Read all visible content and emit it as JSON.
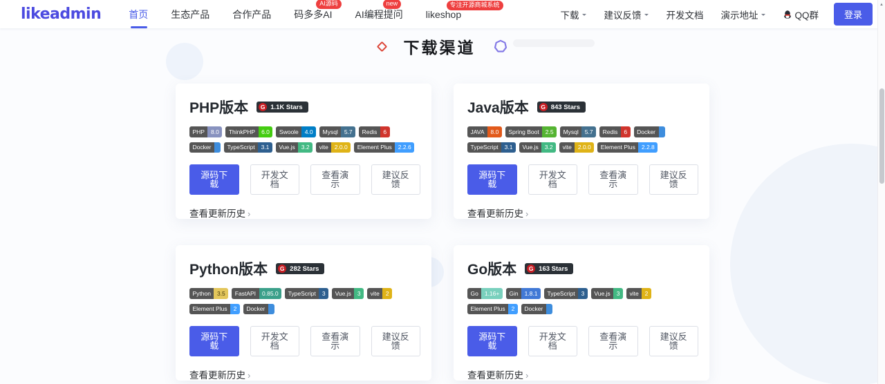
{
  "brand": {
    "logo_text": "likeadmin"
  },
  "nav": {
    "items": [
      {
        "key": "home",
        "label": "首页",
        "active": true
      },
      {
        "key": "eco-products",
        "label": "生态产品"
      },
      {
        "key": "partner-products",
        "label": "合作产品"
      },
      {
        "key": "mdd-ai",
        "label": "码多多AI",
        "badge": "AI源码"
      },
      {
        "key": "ai-coding",
        "label": "AI编程提问",
        "badge": "new"
      },
      {
        "key": "likeshop",
        "label": "likeshop",
        "badge": "专注开源商城系统"
      }
    ],
    "right_items": [
      {
        "key": "download",
        "label": "下载",
        "caret": true
      },
      {
        "key": "feedback",
        "label": "建议反馈",
        "caret": true
      },
      {
        "key": "dev-docs",
        "label": "开发文档"
      },
      {
        "key": "demo",
        "label": "演示地址",
        "caret": true
      },
      {
        "key": "qq-group",
        "label": "QQ群",
        "icon": "qq"
      }
    ],
    "login_label": "登录"
  },
  "section": {
    "title": "下载渠道"
  },
  "card_actions": {
    "primary_label": "源码下载",
    "secondary_labels": [
      "开发文档",
      "查看演示",
      "建议反馈"
    ],
    "history_label": "查看更新历史",
    "history_arrow": "›"
  },
  "cards": [
    {
      "key": "php",
      "title": "PHP版本",
      "stars": "1.1K Stars",
      "badges": [
        {
          "label": "PHP",
          "value": "8.0",
          "color": "#8892bf"
        },
        {
          "label": "ThinkPHP",
          "value": "6.0",
          "color": "#44cc11"
        },
        {
          "label": "Swoole",
          "value": "4.0",
          "color": "#007ec6"
        },
        {
          "label": "Mysql",
          "value": "5.7",
          "color": "#44718f"
        },
        {
          "label": "Redis",
          "value": "6",
          "color": "#d0342c"
        },
        {
          "label": "Docker",
          "value": "",
          "color": "#3e8ddd"
        },
        {
          "label": "TypeScript",
          "value": "3.1",
          "color": "#2e5f8f"
        },
        {
          "label": "Vue.js",
          "value": "3.2",
          "color": "#42b983"
        },
        {
          "label": "vite",
          "value": "2.0.0",
          "color": "#dfb317"
        },
        {
          "label": "Element Plus",
          "value": "2.2.6",
          "color": "#409eff"
        }
      ]
    },
    {
      "key": "java",
      "title": "Java版本",
      "stars": "843 Stars",
      "badges": [
        {
          "label": "JAVA",
          "value": "8.0",
          "color": "#e25a1b"
        },
        {
          "label": "Spring Boot",
          "value": "2.5",
          "color": "#55b432"
        },
        {
          "label": "Mysql",
          "value": "5.7",
          "color": "#44718f"
        },
        {
          "label": "Redis",
          "value": "6",
          "color": "#d0342c"
        },
        {
          "label": "Docker",
          "value": "",
          "color": "#3e8ddd"
        },
        {
          "label": "TypeScript",
          "value": "3.1",
          "color": "#2e5f8f"
        },
        {
          "label": "Vue.js",
          "value": "3.2",
          "color": "#42b983"
        },
        {
          "label": "vite",
          "value": "2.0.0",
          "color": "#dfb317"
        },
        {
          "label": "Element Plus",
          "value": "2.2.8",
          "color": "#409eff"
        }
      ]
    },
    {
      "key": "python",
      "title": "Python版本",
      "stars": "282 Stars",
      "badges": [
        {
          "label": "Python",
          "value": "3.5",
          "color": "#e3c65b",
          "text": "#44380a"
        },
        {
          "label": "FastAPI",
          "value": "0.85.0",
          "color": "#3ba08a"
        },
        {
          "label": "TypeScript",
          "value": "3",
          "color": "#2e5f8f"
        },
        {
          "label": "Vue.js",
          "value": "3",
          "color": "#42b983"
        },
        {
          "label": "vite",
          "value": "2",
          "color": "#dfb317"
        },
        {
          "label": "Element Plus",
          "value": "2",
          "color": "#409eff"
        },
        {
          "label": "Docker",
          "value": "",
          "color": "#3e8ddd"
        }
      ]
    },
    {
      "key": "go",
      "title": "Go版本",
      "stars": "163 Stars",
      "badges": [
        {
          "label": "Go",
          "value": "1.16+",
          "color": "#79d0bd"
        },
        {
          "label": "Gin",
          "value": "1.8.1",
          "color": "#4179d6"
        },
        {
          "label": "TypeScript",
          "value": "3",
          "color": "#2e5f8f"
        },
        {
          "label": "Vue.js",
          "value": "3",
          "color": "#42b983"
        },
        {
          "label": "vite",
          "value": "2",
          "color": "#dfb317"
        },
        {
          "label": "Element Plus",
          "value": "2",
          "color": "#409eff"
        },
        {
          "label": "Docker",
          "value": "",
          "color": "#3e8ddd"
        }
      ]
    }
  ],
  "icons": {
    "gitee_glyph": "G",
    "scroll_up_glyph": "▲"
  },
  "colors": {
    "accent": "#4a5ce8",
    "logo": "#4c4be0",
    "badge_label_bg": "#555555",
    "stars_bg": "#2b3137",
    "gitee_red": "#c71d23",
    "nav_badge_red": "#ee3f3f"
  }
}
